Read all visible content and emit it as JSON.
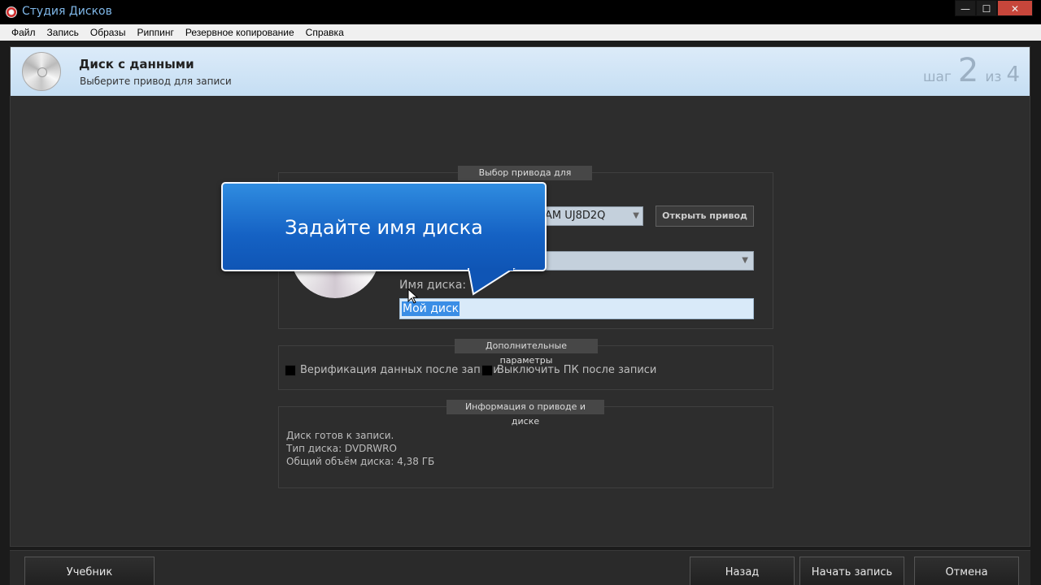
{
  "window": {
    "title": "Студия Дисков",
    "controls": [
      "—",
      "☐",
      "✕"
    ]
  },
  "menu": [
    "Файл",
    "Запись",
    "Образы",
    "Риппинг",
    "Резервное копирование",
    "Справка"
  ],
  "header": {
    "title": "Диск с данными",
    "subtitle": "Выберите привод для записи",
    "step_word": "шаг",
    "step_current": "2",
    "step_of": "из",
    "step_total": "4"
  },
  "drive_group": {
    "title": "Выбор привода для записи",
    "drive_value": "AM UJ8D2Q",
    "open_drive_button": "Открыть привод",
    "name_label": "Имя диска:",
    "name_value": "Мой диск"
  },
  "tooltip": {
    "text": "Задайте имя диска"
  },
  "extra_group": {
    "title": "Дополнительные параметры",
    "verify_label": "Верификация данных после записи",
    "shutdown_label": "Выключить ПК после записи"
  },
  "info_group": {
    "title": "Информация о приводе и диске",
    "lines": [
      "Диск готов к записи.",
      "Тип диска: DVDRWRO",
      "Общий объём диска: 4,38 ГБ"
    ]
  },
  "footer": {
    "tutorial": "Учебник",
    "back": "Назад",
    "start": "Начать запись",
    "cancel": "Отмена"
  }
}
